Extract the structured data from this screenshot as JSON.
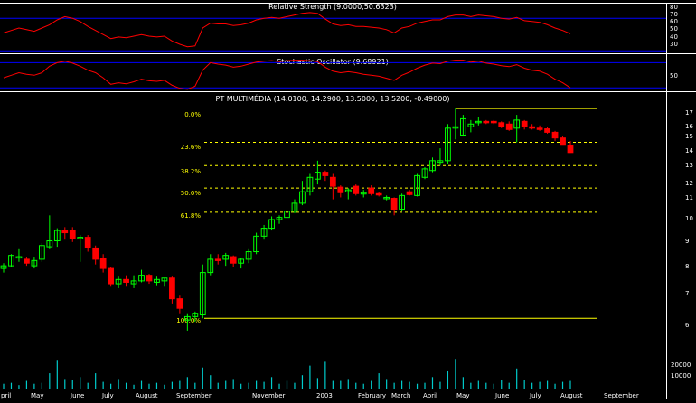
{
  "colors": {
    "background": "#000000",
    "up_candle": "#00ff00",
    "down_candle": "#ff0000",
    "indicator_line": "#ff0000",
    "indicator_bands": "#0000ff",
    "fib_lines": "#ffff00",
    "volume": "#00cccc",
    "text": "#ffffff",
    "axis": "#ffffff"
  },
  "rsi": {
    "title": "Relative Strength (9.0000,50.6323)",
    "ticks": [
      "80",
      "70",
      "60",
      "50",
      "40",
      "30"
    ]
  },
  "stochastic": {
    "title": "Stochastic Oscillator (9.68921)",
    "ticks": [
      "50"
    ]
  },
  "main": {
    "title": "PT MULTIMÉDIA (14.0100, 14.2900, 13.5000, 13.5200, -0.49000)",
    "ticks": [
      "17",
      "16",
      "15",
      "14",
      "13",
      "12",
      "11",
      "10",
      "9",
      "8",
      "7",
      "6"
    ],
    "fib_labels": [
      "0.0%",
      "23.6%",
      "38.2%",
      "50.0%",
      "61.8%",
      "100.0%"
    ]
  },
  "volume": {
    "ticks": [
      "20000",
      "10000"
    ]
  },
  "x_axis": {
    "labels": [
      "pril",
      "May",
      "June",
      "July",
      "August",
      "September",
      "November",
      "2003",
      "February",
      "March",
      "April",
      "May",
      "June",
      "July",
      "August",
      "September"
    ]
  },
  "chart_data": {
    "type": "candlestick",
    "title": "PT MULTIMÉDIA (14.0100, 14.2900, 13.5000, 13.5200, -0.49000)",
    "period": "weekly",
    "x_range": [
      "April 2002",
      "September 2003"
    ],
    "ylim": [
      5.6,
      17.6
    ],
    "y_scale": "log",
    "fibonacci_retracement": {
      "high": 16.7,
      "low": 6.1,
      "levels": [
        {
          "label": "0.0%",
          "value": 16.7
        },
        {
          "label": "23.6%",
          "value": 14.2
        },
        {
          "label": "38.2%",
          "value": 12.7
        },
        {
          "label": "50.0%",
          "value": 11.4
        },
        {
          "label": "61.8%",
          "value": 10.15
        },
        {
          "label": "100.0%",
          "value": 6.1
        }
      ]
    },
    "candles": [
      {
        "o": 7.75,
        "h": 7.95,
        "l": 7.6,
        "c": 7.85
      },
      {
        "o": 7.85,
        "h": 8.3,
        "l": 7.8,
        "c": 8.25
      },
      {
        "o": 8.2,
        "h": 8.5,
        "l": 8.0,
        "c": 8.2
      },
      {
        "o": 8.1,
        "h": 8.2,
        "l": 7.85,
        "c": 7.95
      },
      {
        "o": 7.85,
        "h": 8.2,
        "l": 7.75,
        "c": 8.05
      },
      {
        "o": 8.1,
        "h": 8.75,
        "l": 8.0,
        "c": 8.65
      },
      {
        "o": 8.6,
        "h": 10.0,
        "l": 8.5,
        "c": 8.85
      },
      {
        "o": 8.85,
        "h": 9.4,
        "l": 8.6,
        "c": 9.3
      },
      {
        "o": 9.3,
        "h": 9.45,
        "l": 8.9,
        "c": 9.2
      },
      {
        "o": 9.3,
        "h": 9.45,
        "l": 8.8,
        "c": 8.95
      },
      {
        "o": 8.95,
        "h": 9.1,
        "l": 8.0,
        "c": 9.0
      },
      {
        "o": 9.0,
        "h": 9.1,
        "l": 8.4,
        "c": 8.55
      },
      {
        "o": 8.55,
        "h": 8.65,
        "l": 7.9,
        "c": 8.1
      },
      {
        "o": 8.15,
        "h": 8.3,
        "l": 7.6,
        "c": 7.75
      },
      {
        "o": 7.75,
        "h": 7.8,
        "l": 7.1,
        "c": 7.2
      },
      {
        "o": 7.2,
        "h": 7.45,
        "l": 7.05,
        "c": 7.35
      },
      {
        "o": 7.35,
        "h": 7.5,
        "l": 7.1,
        "c": 7.25
      },
      {
        "o": 7.2,
        "h": 7.5,
        "l": 7.05,
        "c": 7.3
      },
      {
        "o": 7.3,
        "h": 7.7,
        "l": 7.25,
        "c": 7.5
      },
      {
        "o": 7.5,
        "h": 7.55,
        "l": 7.2,
        "c": 7.3
      },
      {
        "o": 7.25,
        "h": 7.45,
        "l": 7.15,
        "c": 7.35
      },
      {
        "o": 7.3,
        "h": 7.4,
        "l": 7.1,
        "c": 7.4
      },
      {
        "o": 7.4,
        "h": 7.45,
        "l": 6.55,
        "c": 6.7
      },
      {
        "o": 6.7,
        "h": 6.8,
        "l": 6.25,
        "c": 6.4
      },
      {
        "o": 6.05,
        "h": 6.25,
        "l": 5.75,
        "c": 6.15
      },
      {
        "o": 6.15,
        "h": 6.3,
        "l": 6.0,
        "c": 6.25
      },
      {
        "o": 6.2,
        "h": 7.9,
        "l": 6.1,
        "c": 7.6
      },
      {
        "o": 7.6,
        "h": 8.3,
        "l": 7.5,
        "c": 8.1
      },
      {
        "o": 8.1,
        "h": 8.3,
        "l": 7.9,
        "c": 8.05
      },
      {
        "o": 8.1,
        "h": 8.35,
        "l": 7.85,
        "c": 8.25
      },
      {
        "o": 8.2,
        "h": 8.25,
        "l": 7.8,
        "c": 7.95
      },
      {
        "o": 7.95,
        "h": 8.15,
        "l": 7.75,
        "c": 8.1
      },
      {
        "o": 8.1,
        "h": 8.5,
        "l": 7.95,
        "c": 8.4
      },
      {
        "o": 8.4,
        "h": 9.2,
        "l": 8.3,
        "c": 9.05
      },
      {
        "o": 9.05,
        "h": 9.55,
        "l": 8.9,
        "c": 9.4
      },
      {
        "o": 9.4,
        "h": 9.95,
        "l": 9.3,
        "c": 9.8
      },
      {
        "o": 9.8,
        "h": 10.0,
        "l": 9.6,
        "c": 9.9
      },
      {
        "o": 9.9,
        "h": 10.6,
        "l": 9.85,
        "c": 10.2
      },
      {
        "o": 10.2,
        "h": 10.8,
        "l": 10.1,
        "c": 10.6
      },
      {
        "o": 10.6,
        "h": 11.8,
        "l": 10.5,
        "c": 11.2
      },
      {
        "o": 11.2,
        "h": 12.2,
        "l": 11.0,
        "c": 12.0
      },
      {
        "o": 11.9,
        "h": 13.0,
        "l": 11.6,
        "c": 12.3
      },
      {
        "o": 12.3,
        "h": 12.4,
        "l": 11.8,
        "c": 12.1
      },
      {
        "o": 12.0,
        "h": 12.2,
        "l": 10.8,
        "c": 11.5
      },
      {
        "o": 11.45,
        "h": 11.55,
        "l": 10.9,
        "c": 11.15
      },
      {
        "o": 11.2,
        "h": 11.4,
        "l": 10.8,
        "c": 11.3
      },
      {
        "o": 11.5,
        "h": 11.6,
        "l": 11.0,
        "c": 11.1
      },
      {
        "o": 11.1,
        "h": 11.3,
        "l": 10.9,
        "c": 11.15
      },
      {
        "o": 11.4,
        "h": 11.55,
        "l": 11.0,
        "c": 11.1
      },
      {
        "o": 11.1,
        "h": 11.2,
        "l": 10.95,
        "c": 11.05
      },
      {
        "o": 10.9,
        "h": 11.0,
        "l": 10.75,
        "c": 10.9
      },
      {
        "o": 10.85,
        "h": 10.9,
        "l": 10.0,
        "c": 10.3
      },
      {
        "o": 10.3,
        "h": 11.1,
        "l": 10.2,
        "c": 11.0
      },
      {
        "o": 11.2,
        "h": 11.3,
        "l": 11.0,
        "c": 11.05
      },
      {
        "o": 11.0,
        "h": 12.2,
        "l": 10.95,
        "c": 12.1
      },
      {
        "o": 12.0,
        "h": 12.6,
        "l": 11.9,
        "c": 12.5
      },
      {
        "o": 12.4,
        "h": 13.2,
        "l": 12.3,
        "c": 13.0
      },
      {
        "o": 12.9,
        "h": 13.8,
        "l": 12.7,
        "c": 13.0
      },
      {
        "o": 13.0,
        "h": 15.5,
        "l": 12.8,
        "c": 15.2
      },
      {
        "o": 15.2,
        "h": 16.7,
        "l": 14.4,
        "c": 15.3
      },
      {
        "o": 14.7,
        "h": 16.2,
        "l": 14.6,
        "c": 15.9
      },
      {
        "o": 15.3,
        "h": 15.8,
        "l": 14.9,
        "c": 15.5
      },
      {
        "o": 15.6,
        "h": 16.0,
        "l": 15.4,
        "c": 15.7
      },
      {
        "o": 15.7,
        "h": 15.8,
        "l": 15.5,
        "c": 15.65
      },
      {
        "o": 15.7,
        "h": 15.8,
        "l": 15.5,
        "c": 15.65
      },
      {
        "o": 15.6,
        "h": 15.7,
        "l": 15.2,
        "c": 15.3
      },
      {
        "o": 15.5,
        "h": 15.7,
        "l": 15.0,
        "c": 15.1
      },
      {
        "o": 15.2,
        "h": 16.2,
        "l": 14.2,
        "c": 15.8
      },
      {
        "o": 15.7,
        "h": 15.8,
        "l": 15.1,
        "c": 15.3
      },
      {
        "o": 15.3,
        "h": 15.5,
        "l": 15.1,
        "c": 15.2
      },
      {
        "o": 15.2,
        "h": 15.4,
        "l": 15.0,
        "c": 15.15
      },
      {
        "o": 15.15,
        "h": 15.3,
        "l": 14.8,
        "c": 14.9
      },
      {
        "o": 14.9,
        "h": 15.0,
        "l": 14.3,
        "c": 14.5
      },
      {
        "o": 14.5,
        "h": 14.6,
        "l": 14.0,
        "c": 14.0
      },
      {
        "o": 14.01,
        "h": 14.29,
        "l": 13.5,
        "c": 13.52
      }
    ],
    "volume": [
      2500,
      3000,
      1800,
      4000,
      2500,
      3000,
      8000,
      15000,
      5000,
      4500,
      6000,
      3000,
      8000,
      3500,
      2500,
      5000,
      3000,
      2000,
      4000,
      2500,
      3000,
      2000,
      3500,
      4000,
      6000,
      3000,
      11000,
      7000,
      3000,
      4000,
      5000,
      2500,
      3000,
      4000,
      3500,
      6000,
      2500,
      4000,
      3000,
      7000,
      12000,
      5500,
      14000,
      4000,
      4000,
      5000,
      3000,
      2500,
      4000,
      8000,
      5000,
      3000,
      4000,
      3500,
      2500,
      3000,
      6000,
      3500,
      9000,
      15500,
      6000,
      3000,
      4000,
      3000,
      2500,
      4500,
      3000,
      10500,
      4500,
      3000,
      3500,
      4000,
      2500,
      3500,
      4000
    ],
    "volume_ylim": [
      0,
      26000
    ],
    "rsi_series": [
      52,
      55,
      58,
      56,
      54,
      58,
      62,
      68,
      72,
      70,
      66,
      60,
      55,
      50,
      45,
      47,
      46,
      48,
      50,
      48,
      47,
      48,
      42,
      38,
      35,
      36,
      58,
      64,
      63,
      63,
      61,
      62,
      64,
      68,
      70,
      71,
      70,
      72,
      74,
      76,
      77,
      76,
      69,
      63,
      61,
      62,
      60,
      60,
      59,
      58,
      56,
      52,
      58,
      60,
      64,
      66,
      68,
      68,
      72,
      74,
      74,
      72,
      74,
      73,
      72,
      70,
      69,
      71,
      67,
      66,
      65,
      62,
      58,
      55,
      51
    ],
    "rsi_ylim": [
      28,
      88
    ],
    "rsi_bands": [
      30,
      70
    ],
    "stoch_series": [
      45,
      50,
      55,
      52,
      50,
      55,
      68,
      75,
      78,
      74,
      68,
      60,
      55,
      45,
      32,
      35,
      33,
      37,
      42,
      39,
      38,
      40,
      30,
      24,
      22,
      28,
      60,
      75,
      72,
      70,
      66,
      68,
      72,
      76,
      78,
      79,
      77,
      79,
      80,
      80,
      79,
      77,
      66,
      58,
      55,
      57,
      55,
      52,
      50,
      48,
      44,
      40,
      50,
      56,
      64,
      70,
      74,
      73,
      78,
      80,
      80,
      76,
      78,
      74,
      72,
      69,
      67,
      71,
      64,
      60,
      58,
      52,
      42,
      35,
      25
    ],
    "stoch_ylim": [
      20,
      90
    ],
    "stoch_bands": [
      25,
      75
    ]
  }
}
